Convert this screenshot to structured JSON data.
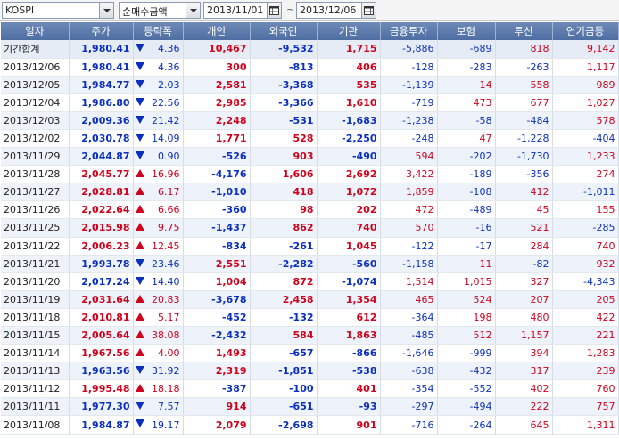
{
  "toolbar": {
    "market": "KOSPI",
    "mode": "순매수금액",
    "start_date": "2013/11/01",
    "end_date": "2013/12/06",
    "date_separator": "~"
  },
  "columns": [
    "일자",
    "주가",
    "등락폭",
    "개인",
    "외국인",
    "기관",
    "금융투자",
    "보험",
    "투신",
    "연기금등"
  ],
  "colors": {
    "up": "#d0021b",
    "down": "#0a2fbf",
    "header": "#5b79ab"
  },
  "rows": [
    {
      "date": "기간합계",
      "price": "1,980.41",
      "dir": "down",
      "change": "4.36",
      "indiv": "10,467",
      "foreign": "-9,532",
      "inst": "1,715",
      "fin": "-5,886",
      "ins": "-689",
      "trust": "818",
      "pension": "9,142"
    },
    {
      "date": "2013/12/06",
      "price": "1,980.41",
      "dir": "down",
      "change": "4.36",
      "indiv": "300",
      "foreign": "-813",
      "inst": "406",
      "fin": "-128",
      "ins": "-283",
      "trust": "-263",
      "pension": "1,117"
    },
    {
      "date": "2013/12/05",
      "price": "1,984.77",
      "dir": "down",
      "change": "2.03",
      "indiv": "2,581",
      "foreign": "-3,368",
      "inst": "535",
      "fin": "-1,139",
      "ins": "14",
      "trust": "558",
      "pension": "989"
    },
    {
      "date": "2013/12/04",
      "price": "1,986.80",
      "dir": "down",
      "change": "22.56",
      "indiv": "2,985",
      "foreign": "-3,366",
      "inst": "1,610",
      "fin": "-719",
      "ins": "473",
      "trust": "677",
      "pension": "1,027"
    },
    {
      "date": "2013/12/03",
      "price": "2,009.36",
      "dir": "down",
      "change": "21.42",
      "indiv": "2,248",
      "foreign": "-531",
      "inst": "-1,683",
      "fin": "-1,238",
      "ins": "-58",
      "trust": "-484",
      "pension": "578"
    },
    {
      "date": "2013/12/02",
      "price": "2,030.78",
      "dir": "down",
      "change": "14.09",
      "indiv": "1,771",
      "foreign": "528",
      "inst": "-2,250",
      "fin": "-248",
      "ins": "47",
      "trust": "-1,228",
      "pension": "-404"
    },
    {
      "date": "2013/11/29",
      "price": "2,044.87",
      "dir": "down",
      "change": "0.90",
      "indiv": "-526",
      "foreign": "903",
      "inst": "-490",
      "fin": "594",
      "ins": "-202",
      "trust": "-1,730",
      "pension": "1,233"
    },
    {
      "date": "2013/11/28",
      "price": "2,045.77",
      "dir": "up",
      "change": "16.96",
      "indiv": "-4,176",
      "foreign": "1,606",
      "inst": "2,692",
      "fin": "3,422",
      "ins": "-189",
      "trust": "-356",
      "pension": "274"
    },
    {
      "date": "2013/11/27",
      "price": "2,028.81",
      "dir": "up",
      "change": "6.17",
      "indiv": "-1,010",
      "foreign": "418",
      "inst": "1,072",
      "fin": "1,859",
      "ins": "-108",
      "trust": "412",
      "pension": "-1,011"
    },
    {
      "date": "2013/11/26",
      "price": "2,022.64",
      "dir": "up",
      "change": "6.66",
      "indiv": "-360",
      "foreign": "98",
      "inst": "202",
      "fin": "472",
      "ins": "-489",
      "trust": "45",
      "pension": "155"
    },
    {
      "date": "2013/11/25",
      "price": "2,015.98",
      "dir": "up",
      "change": "9.75",
      "indiv": "-1,437",
      "foreign": "862",
      "inst": "740",
      "fin": "570",
      "ins": "-16",
      "trust": "521",
      "pension": "-285"
    },
    {
      "date": "2013/11/22",
      "price": "2,006.23",
      "dir": "up",
      "change": "12.45",
      "indiv": "-834",
      "foreign": "-261",
      "inst": "1,045",
      "fin": "-122",
      "ins": "-17",
      "trust": "284",
      "pension": "740"
    },
    {
      "date": "2013/11/21",
      "price": "1,993.78",
      "dir": "down",
      "change": "23.46",
      "indiv": "2,551",
      "foreign": "-2,282",
      "inst": "-560",
      "fin": "-1,158",
      "ins": "11",
      "trust": "-82",
      "pension": "932"
    },
    {
      "date": "2013/11/20",
      "price": "2,017.24",
      "dir": "down",
      "change": "14.40",
      "indiv": "1,004",
      "foreign": "872",
      "inst": "-1,074",
      "fin": "1,514",
      "ins": "1,015",
      "trust": "327",
      "pension": "-4,343"
    },
    {
      "date": "2013/11/19",
      "price": "2,031.64",
      "dir": "up",
      "change": "20.83",
      "indiv": "-3,678",
      "foreign": "2,458",
      "inst": "1,354",
      "fin": "465",
      "ins": "524",
      "trust": "207",
      "pension": "205"
    },
    {
      "date": "2013/11/18",
      "price": "2,010.81",
      "dir": "up",
      "change": "5.17",
      "indiv": "-452",
      "foreign": "-132",
      "inst": "612",
      "fin": "-364",
      "ins": "198",
      "trust": "480",
      "pension": "422"
    },
    {
      "date": "2013/11/15",
      "price": "2,005.64",
      "dir": "up",
      "change": "38.08",
      "indiv": "-2,432",
      "foreign": "584",
      "inst": "1,863",
      "fin": "-485",
      "ins": "512",
      "trust": "1,157",
      "pension": "221"
    },
    {
      "date": "2013/11/14",
      "price": "1,967.56",
      "dir": "up",
      "change": "4.00",
      "indiv": "1,493",
      "foreign": "-657",
      "inst": "-866",
      "fin": "-1,646",
      "ins": "-999",
      "trust": "394",
      "pension": "1,283"
    },
    {
      "date": "2013/11/13",
      "price": "1,963.56",
      "dir": "down",
      "change": "31.92",
      "indiv": "2,319",
      "foreign": "-1,851",
      "inst": "-538",
      "fin": "-638",
      "ins": "-432",
      "trust": "317",
      "pension": "239"
    },
    {
      "date": "2013/11/12",
      "price": "1,995.48",
      "dir": "up",
      "change": "18.18",
      "indiv": "-387",
      "foreign": "-100",
      "inst": "401",
      "fin": "-354",
      "ins": "-552",
      "trust": "402",
      "pension": "760"
    },
    {
      "date": "2013/11/11",
      "price": "1,977.30",
      "dir": "down",
      "change": "7.57",
      "indiv": "914",
      "foreign": "-651",
      "inst": "-93",
      "fin": "-297",
      "ins": "-494",
      "trust": "222",
      "pension": "757"
    },
    {
      "date": "2013/11/08",
      "price": "1,984.87",
      "dir": "down",
      "change": "19.17",
      "indiv": "2,079",
      "foreign": "-2,698",
      "inst": "901",
      "fin": "-716",
      "ins": "-264",
      "trust": "645",
      "pension": "1,311"
    }
  ]
}
